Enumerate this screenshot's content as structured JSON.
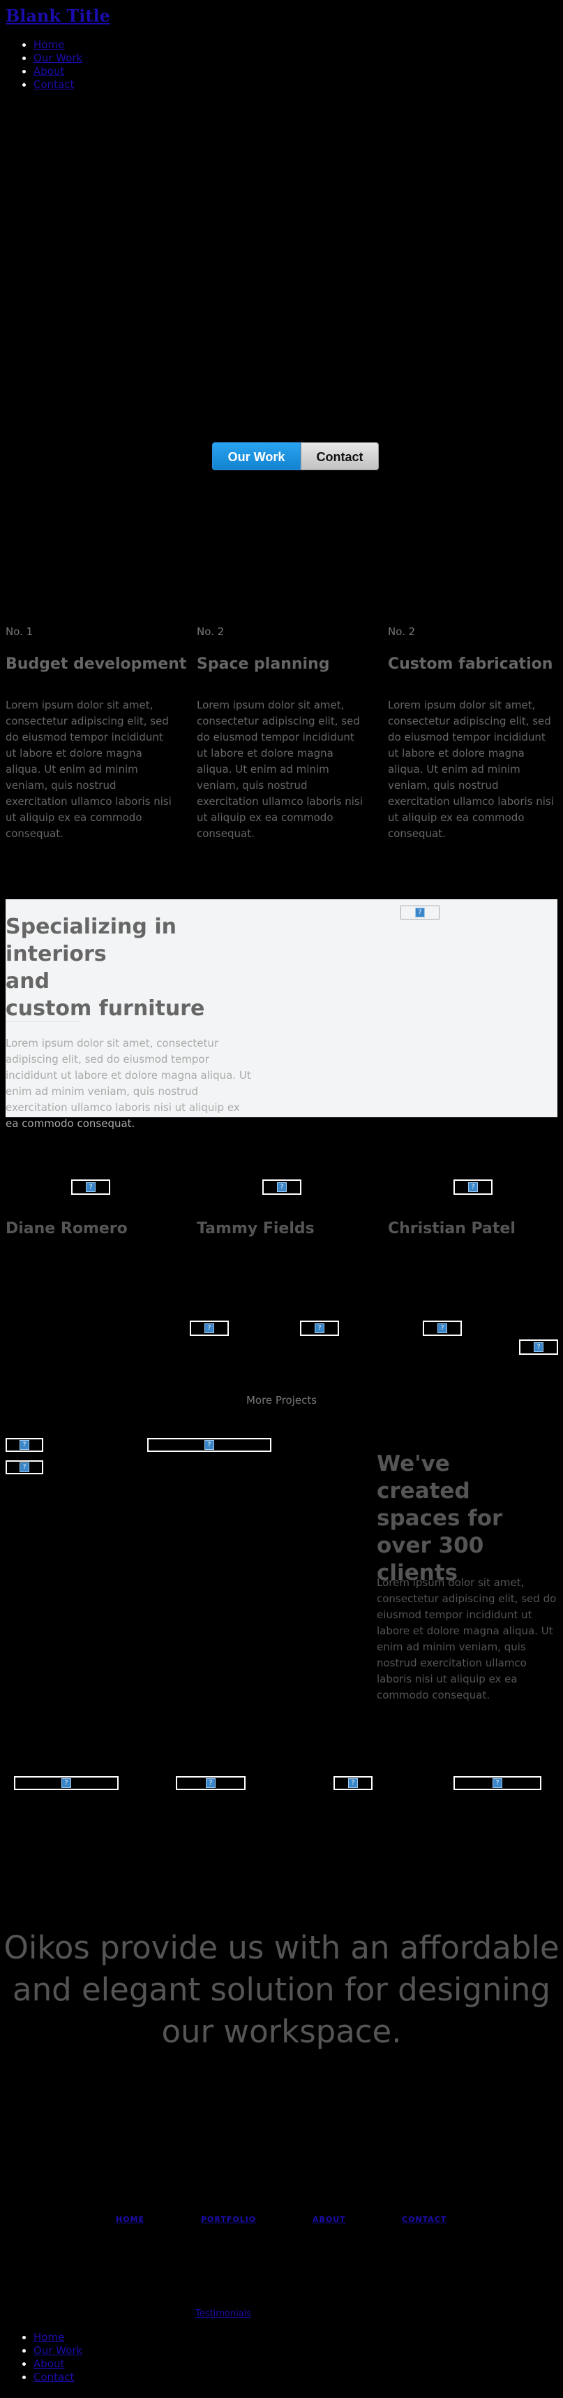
{
  "header": {
    "site_title": "Blank Title",
    "nav": [
      "Home",
      "Our Work",
      "About",
      "Contact"
    ]
  },
  "hero": {
    "buttons": [
      "Our Work",
      "Contact"
    ]
  },
  "services": [
    {
      "number": "No. 1",
      "title": "Budget development",
      "text": "Lorem ipsum dolor sit amet, consectetur adipiscing elit, sed do eiusmod tempor incididunt ut labore et dolore magna aliqua. Ut enim ad minim veniam, quis nostrud exercitation ullamco laboris nisi ut aliquip ex ea commodo consequat."
    },
    {
      "number": "No. 2",
      "title": "Space planning",
      "text": "Lorem ipsum dolor sit amet, consectetur adipiscing elit, sed do eiusmod tempor incididunt ut labore et dolore magna aliqua. Ut enim ad minim veniam, quis nostrud exercitation ullamco laboris nisi ut aliquip ex ea commodo consequat."
    },
    {
      "number": "No. 2",
      "title": "Custom fabrication",
      "text": "Lorem ipsum dolor sit amet, consectetur adipiscing elit, sed do eiusmod tempor incididunt ut labore et dolore magna aliqua. Ut enim ad minim veniam, quis nostrud exercitation ullamco laboris nisi ut aliquip ex ea commodo consequat."
    }
  ],
  "feature": {
    "title_line1": "Specializing in interiors",
    "title_line2": "and",
    "title_line3": "custom furniture",
    "text": "Lorem ipsum dolor sit amet, consectetur adipiscing elit, sed do eiusmod tempor incididunt ut labore et dolore magna aliqua. Ut enim ad minim veniam, quis nostrud exercitation ullamco laboris nisi ut aliquip ex ea commodo consequat."
  },
  "team": [
    "Diane Romero",
    "Tammy Fields",
    "Christian Patel"
  ],
  "projects": {
    "more_label": "More Projects"
  },
  "clients": {
    "title": "We've created spaces for over 300 clients",
    "text": "Lorem ipsum dolor sit amet, consectetur adipiscing elit, sed do eiusmod tempor incididunt ut labore et dolore magna aliqua. Ut enim ad minim veniam, quis nostrud exercitation ullamco laboris nisi ut aliquip ex ea commodo consequat."
  },
  "testimonial": {
    "quote": "Oikos provide us with an affordable and elegant solution for designing our workspace."
  },
  "footer": {
    "links": [
      "HOME",
      "PORTFOLIO",
      "ABOUT",
      "CONTACT"
    ],
    "testimonials_link": "Testimonials",
    "nav": [
      "Home",
      "Our Work",
      "About",
      "Contact"
    ]
  },
  "icons": {
    "broken_image": "broken-image-icon"
  },
  "colors": {
    "primary_button": "#1a8fe0",
    "link": "#1a0dab",
    "feature_bg": "#f2f4f5"
  }
}
